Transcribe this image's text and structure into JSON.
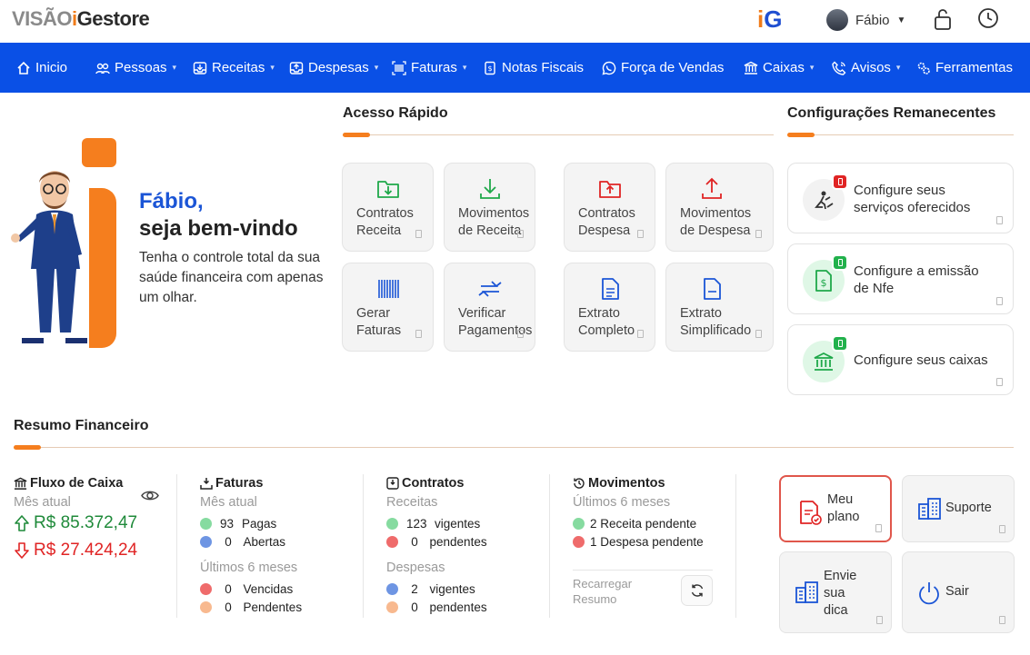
{
  "brand": {
    "logo_part1": "VISÃO",
    "logo_part2": "i",
    "logo_part3": "Gestore",
    "mark_i": "i",
    "mark_g": "G"
  },
  "user": {
    "name": "Fábio"
  },
  "nav": [
    {
      "label": "Inicio",
      "icon": "home-icon",
      "dropdown": false
    },
    {
      "label": "Pessoas",
      "icon": "people-icon",
      "dropdown": true
    },
    {
      "label": "Receitas",
      "icon": "inbox-in-icon",
      "dropdown": true
    },
    {
      "label": "Despesas",
      "icon": "inbox-out-icon",
      "dropdown": true
    },
    {
      "label": "Faturas",
      "icon": "barcode-icon",
      "dropdown": true
    },
    {
      "label": "Notas Fiscais",
      "icon": "receipt-icon",
      "dropdown": false
    },
    {
      "label": "Força de Vendas",
      "icon": "whatsapp-icon",
      "dropdown": false
    },
    {
      "label": "Caixas",
      "icon": "bank-icon",
      "dropdown": true
    },
    {
      "label": "Avisos",
      "icon": "phone-icon",
      "dropdown": true
    },
    {
      "label": "Ferramentas",
      "icon": "cogs-icon",
      "dropdown": false
    }
  ],
  "hero": {
    "greet_name": "Fábio,",
    "greet_line": "seja bem-vindo",
    "description": "Tenha o controle total da sua saúde financeira com apenas um olhar."
  },
  "quick_access": {
    "title": "Acesso Rápido",
    "items": [
      {
        "line1": "Contratos",
        "line2": "Receita",
        "icon": "folder-down-icon",
        "color": "#1fa84a"
      },
      {
        "line1": "Movimentos",
        "line2": "de Receita",
        "icon": "download-icon",
        "color": "#1fa84a"
      },
      {
        "line1": "Contratos",
        "line2": "Despesa",
        "icon": "folder-up-icon",
        "color": "#e02424"
      },
      {
        "line1": "Movimentos",
        "line2": "de Despesa",
        "icon": "upload-icon",
        "color": "#e02424"
      },
      {
        "line1": "Gerar",
        "line2": "Faturas",
        "icon": "barcode-icon",
        "color": "#1b55d6"
      },
      {
        "line1": "Verificar",
        "line2": "Pagamentos",
        "icon": "arrows-exchange-icon",
        "color": "#1b55d6"
      },
      {
        "line1": "Extrato",
        "line2": "Completo",
        "icon": "document-icon",
        "color": "#1b55d6"
      },
      {
        "line1": "Extrato",
        "line2": "Simplificado",
        "icon": "document-minus-icon",
        "color": "#1b55d6"
      }
    ]
  },
  "config": {
    "title": "Configurações Remanecentes",
    "items": [
      {
        "line1": "Configure seus",
        "line2": "serviços oferecidos",
        "icon": "worker-icon",
        "status": "pending"
      },
      {
        "line1": "Configure a emissão",
        "line2": "de Nfe",
        "icon": "invoice-dollar-icon",
        "status": "done"
      },
      {
        "line1": "Configure seus caixas",
        "line2": "",
        "icon": "bank-icon",
        "status": "done"
      }
    ]
  },
  "summary": {
    "title": "Resumo Financeiro",
    "cashflow": {
      "title": "Fluxo de Caixa",
      "period": "Mês atual",
      "income": "R$ 85.372,47",
      "expense": "R$ 27.424,24"
    },
    "invoices": {
      "title": "Faturas",
      "period1": "Mês atual",
      "paid_count": "93",
      "paid_label": "Pagas",
      "open_count": "0",
      "open_label": "Abertas",
      "period2": "Últimos 6 meses",
      "overdue_count": "0",
      "overdue_label": "Vencidas",
      "pending_count": "0",
      "pending_label": "Pendentes"
    },
    "contracts": {
      "title": "Contratos",
      "income_label": "Receitas",
      "income_active": "123",
      "income_active_label": "vigentes",
      "income_pending": "0",
      "income_pending_label": "pendentes",
      "expense_label": "Despesas",
      "expense_active": "2",
      "expense_active_label": "vigentes",
      "expense_pending": "0",
      "expense_pending_label": "pendentes"
    },
    "movements": {
      "title": "Movimentos",
      "period": "Últimos 6 meses",
      "income_pending": "2 Receita pendente",
      "expense_pending": "1 Despesa pendente",
      "reload_line1": "Recarregar",
      "reload_line2": "Resumo"
    }
  },
  "actions": {
    "plan_line1": "Meu",
    "plan_line2": "plano",
    "support": "Suporte",
    "tip_line1": "Envie",
    "tip_line2": "sua",
    "tip_line3": "dica",
    "exit": "Sair"
  },
  "colors": {
    "nav_bg": "#0a50e6",
    "accent": "#f57e1e",
    "green": "#1f8a3a",
    "red": "#e02424",
    "blue": "#1b55d6"
  }
}
